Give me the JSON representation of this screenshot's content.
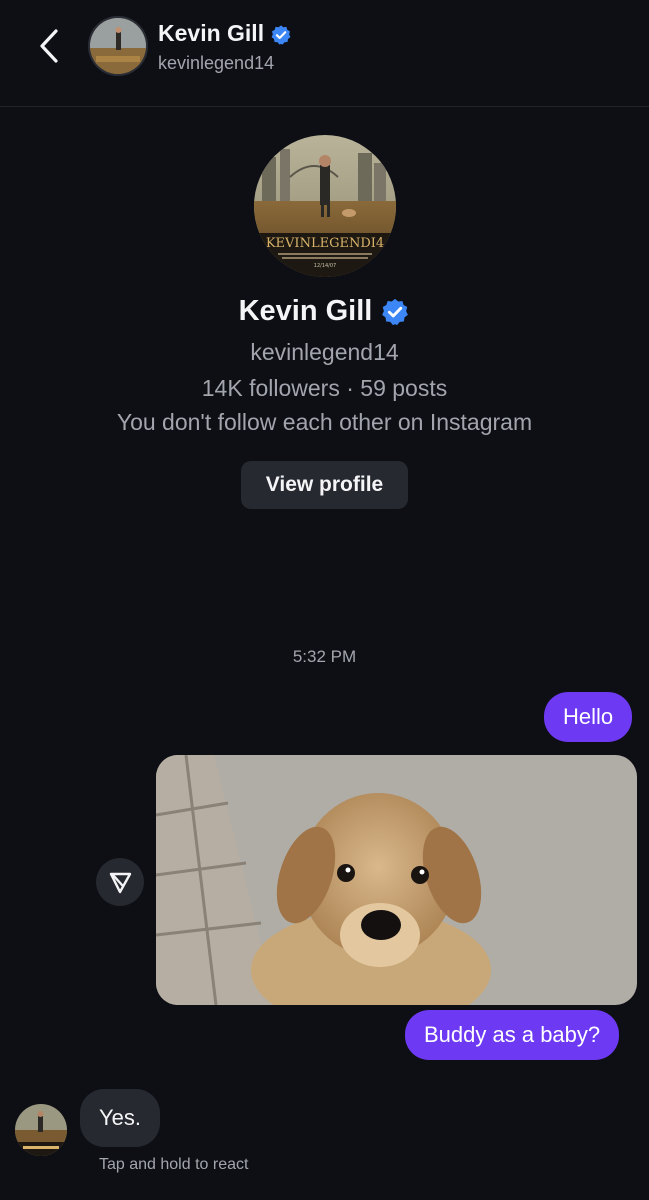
{
  "header": {
    "name": "Kevin Gill",
    "username": "kevinlegend14",
    "back_icon": "chevron-left-icon",
    "verified_icon": "verified-badge-icon"
  },
  "profile": {
    "name": "Kevin Gill",
    "username": "kevinlegend14",
    "stats": "14K followers · 59 posts",
    "relationship": "You don't follow each other on Instagram",
    "view_profile_label": "View profile",
    "avatar_caption": "KEVINLEGENDI4",
    "avatar_date": "12/14/07"
  },
  "thread": {
    "timestamp": "5:32 PM",
    "messages": [
      {
        "from": "me",
        "type": "text",
        "text": "Hello"
      },
      {
        "from": "me",
        "type": "photo",
        "description": "puppy-photo"
      },
      {
        "from": "me",
        "type": "text",
        "text": "Buddy as a baby?"
      },
      {
        "from": "them",
        "type": "text",
        "text": "Yes."
      }
    ],
    "react_hint": "Tap and hold to react",
    "share_icon": "send-triangle-icon"
  },
  "colors": {
    "background": "#0d0f15",
    "outgoing_bubble": "#6d39f2",
    "incoming_bubble": "#262930",
    "verified": "#3d86f5",
    "secondary_text": "#a2a5ad"
  }
}
